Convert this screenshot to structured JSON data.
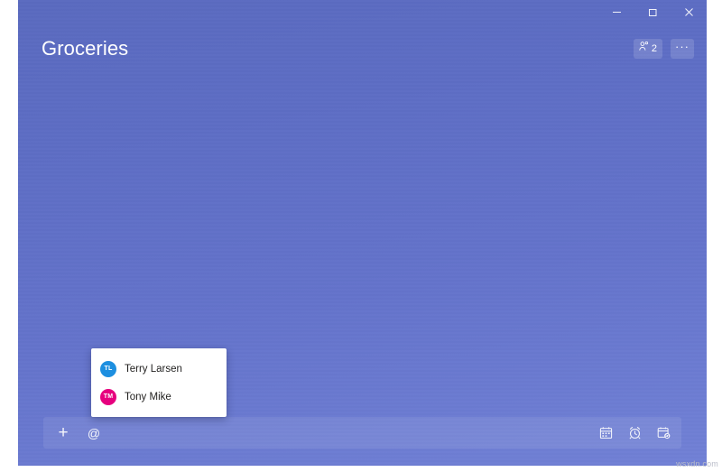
{
  "window": {
    "controls": [
      {
        "name": "minimize",
        "label": "–",
        "title": "Minimize"
      },
      {
        "name": "maximize",
        "label": "❐",
        "title": "Restore Down"
      },
      {
        "name": "close",
        "label": "✕",
        "title": "Close"
      }
    ]
  },
  "header": {
    "title": "Groceries",
    "share": {
      "icon": "person-add-icon",
      "count": "2"
    },
    "more": {
      "icon": "more-horizontal-icon",
      "label": "···"
    }
  },
  "mention_popup": {
    "visible": true,
    "items": [
      {
        "initials": "TL",
        "name": "Terry Larsen",
        "avatar_color": "#1d8fe0"
      },
      {
        "initials": "TM",
        "name": "Tony Mike",
        "avatar_color": "#e6007e"
      }
    ]
  },
  "composer": {
    "left_tools": [
      {
        "name": "add-task-icon",
        "glyph": "+",
        "label": "Add task"
      },
      {
        "name": "mention-icon",
        "glyph": "@",
        "label": "Mention"
      }
    ],
    "right_tools": [
      {
        "name": "due-date-calendar-icon",
        "label": "Add due date"
      },
      {
        "name": "reminder-alarm-icon",
        "label": "Remind me"
      },
      {
        "name": "repeat-calendar-icon",
        "label": "Repeat"
      }
    ]
  },
  "watermark": {
    "text": "wsxdn.com"
  },
  "colors": {
    "background_top": "#5a6abf",
    "background_bottom": "#7181d6",
    "accent_blue": "#1d8fe0",
    "accent_pink": "#e6007e",
    "text_on_accent": "#ffffff"
  }
}
